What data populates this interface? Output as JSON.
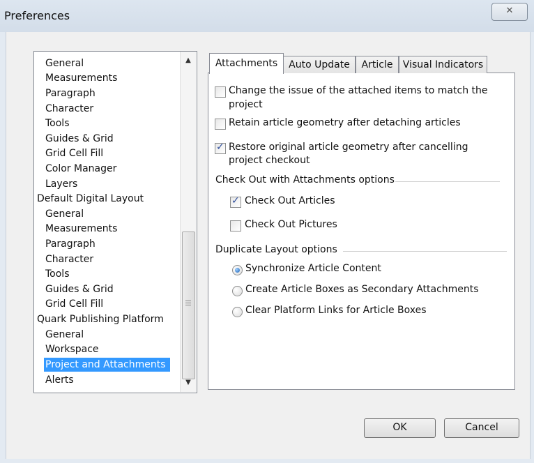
{
  "window": {
    "title": "Preferences",
    "close_glyph": "✕"
  },
  "categories": {
    "items": [
      {
        "label": "General",
        "indent": 1
      },
      {
        "label": "Measurements",
        "indent": 1
      },
      {
        "label": "Paragraph",
        "indent": 1
      },
      {
        "label": "Character",
        "indent": 1
      },
      {
        "label": "Tools",
        "indent": 1
      },
      {
        "label": "Guides & Grid",
        "indent": 1
      },
      {
        "label": "Grid Cell Fill",
        "indent": 1
      },
      {
        "label": "Color Manager",
        "indent": 1
      },
      {
        "label": "Layers",
        "indent": 1
      },
      {
        "label": "Default Digital Layout",
        "indent": 0
      },
      {
        "label": "General",
        "indent": 1
      },
      {
        "label": "Measurements",
        "indent": 1
      },
      {
        "label": "Paragraph",
        "indent": 1
      },
      {
        "label": "Character",
        "indent": 1
      },
      {
        "label": "Tools",
        "indent": 1
      },
      {
        "label": "Guides & Grid",
        "indent": 1
      },
      {
        "label": "Grid Cell Fill",
        "indent": 1
      },
      {
        "label": "Quark Publishing Platform",
        "indent": 0
      },
      {
        "label": "General",
        "indent": 1
      },
      {
        "label": "Workspace",
        "indent": 1
      },
      {
        "label": "Project and Attachments",
        "indent": 1,
        "selected": true
      },
      {
        "label": "Alerts",
        "indent": 1
      }
    ],
    "scroll_up": "▲",
    "scroll_down": "▼"
  },
  "tabs": [
    {
      "label": "Attachments",
      "active": true
    },
    {
      "label": "Auto Update"
    },
    {
      "label": "Article"
    },
    {
      "label": "Visual Indicators"
    }
  ],
  "attachments": {
    "opt1": {
      "line1": "Change the issue of the attached items to match the",
      "line2": "project",
      "checked": false
    },
    "opt2": {
      "label": "Retain article geometry after detaching articles",
      "checked": false
    },
    "opt3": {
      "line1": "Restore original article geometry after cancelling",
      "line2": "project checkout",
      "checked": true
    },
    "checkout_section": "Check Out with Attachments options",
    "checkout_articles": {
      "label": "Check Out Articles",
      "checked": true
    },
    "checkout_pictures": {
      "label": "Check Out Pictures",
      "checked": false
    },
    "duplicate_section": "Duplicate Layout options",
    "radios": [
      {
        "label": "Synchronize Article Content",
        "selected": true
      },
      {
        "label": "Create Article Boxes as Secondary Attachments",
        "selected": false
      },
      {
        "label": "Clear Platform Links for Article Boxes",
        "selected": false
      }
    ],
    "check_glyph": "✓"
  },
  "buttons": {
    "ok": "OK",
    "cancel": "Cancel"
  },
  "colors": {
    "selection": "#3399ff",
    "titlebar": "#d3dde9"
  }
}
